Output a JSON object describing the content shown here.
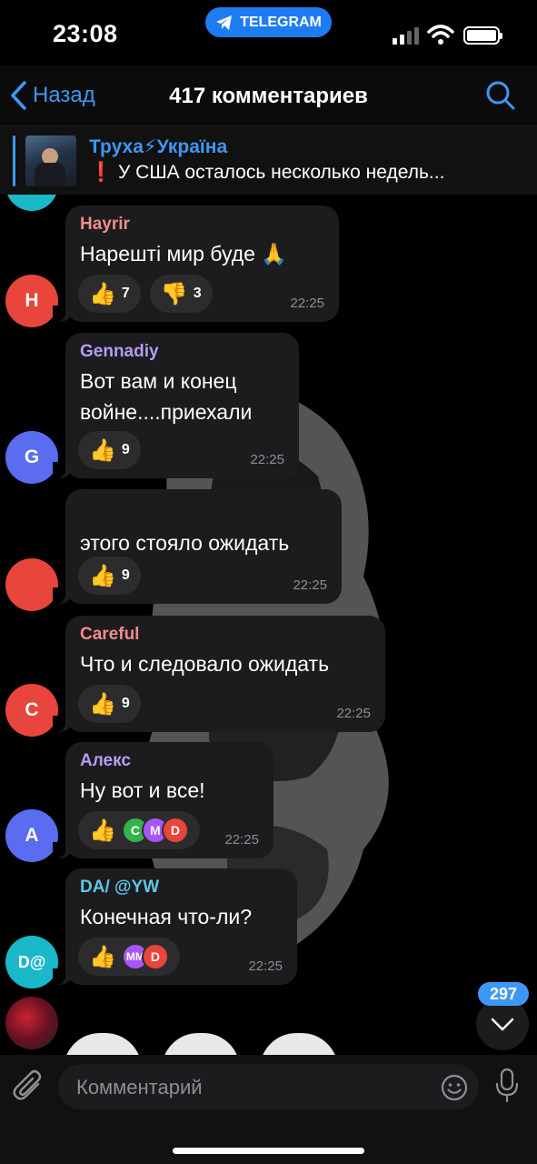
{
  "status": {
    "time": "23:08",
    "app_pill": "TELEGRAM"
  },
  "nav": {
    "back_label": "Назад",
    "title": "417 комментариев"
  },
  "pinned": {
    "channel": "Труха⚡Україна",
    "excl": "❗",
    "text": "У США осталось несколько недель..."
  },
  "messages": [
    {
      "sender": "Hayrir",
      "sender_color": "#f28b8b",
      "text": "Нарешті мир буде 🙏",
      "time": "22:25",
      "avatar_letter": "H",
      "avatar_color": "#e8453c",
      "reactions": [
        {
          "emoji": "👍",
          "count": "7"
        },
        {
          "emoji": "👎",
          "count": "3"
        }
      ]
    },
    {
      "sender": "Gennadiy",
      "sender_color": "#b79cf5",
      "text": "Вот вам и конец войне....приехали",
      "time": "22:25",
      "avatar_letter": "G",
      "avatar_color": "#5a6cf0",
      "reactions": [
        {
          "emoji": "👍",
          "count": "9"
        }
      ]
    },
    {
      "sender": "",
      "sender_color": "#f28b8b",
      "text": "этого стояло ожидать",
      "time": "22:25",
      "avatar_letter": "",
      "avatar_color": "#e8453c",
      "reactions": [
        {
          "emoji": "👍",
          "count": "9"
        }
      ]
    },
    {
      "sender": "Careful",
      "sender_color": "#f28b8b",
      "text": "Что и следовало ожидать",
      "time": "22:25",
      "avatar_letter": "C",
      "avatar_color": "#e8453c",
      "reactions": [
        {
          "emoji": "👍",
          "count": "9"
        }
      ]
    },
    {
      "sender": "Алекс",
      "sender_color": "#b79cf5",
      "text": "Ну вот и все!",
      "time": "22:25",
      "avatar_letter": "A",
      "avatar_color": "#5a6cf0",
      "reactions": [
        {
          "emoji": "👍",
          "reactors": [
            {
              "letter": "C",
              "color": "#36b24a"
            },
            {
              "letter": "M",
              "color": "#a855f7"
            },
            {
              "letter": "D",
              "color": "#e8453c"
            }
          ]
        }
      ]
    },
    {
      "sender": "DA/ @YW",
      "sender_color": "#5bc8e8",
      "text": "Конечная что-ли?",
      "time": "22:25",
      "avatar_letter": "D@",
      "avatar_color": "#1ab8c9",
      "reactions": [
        {
          "emoji": "👍",
          "reactors": [
            {
              "letter": "MM",
              "color": "#a855f7"
            },
            {
              "letter": "D",
              "color": "#e8453c"
            }
          ]
        }
      ]
    }
  ],
  "scroll": {
    "unread_count": "297"
  },
  "input": {
    "placeholder": "Комментарий"
  }
}
